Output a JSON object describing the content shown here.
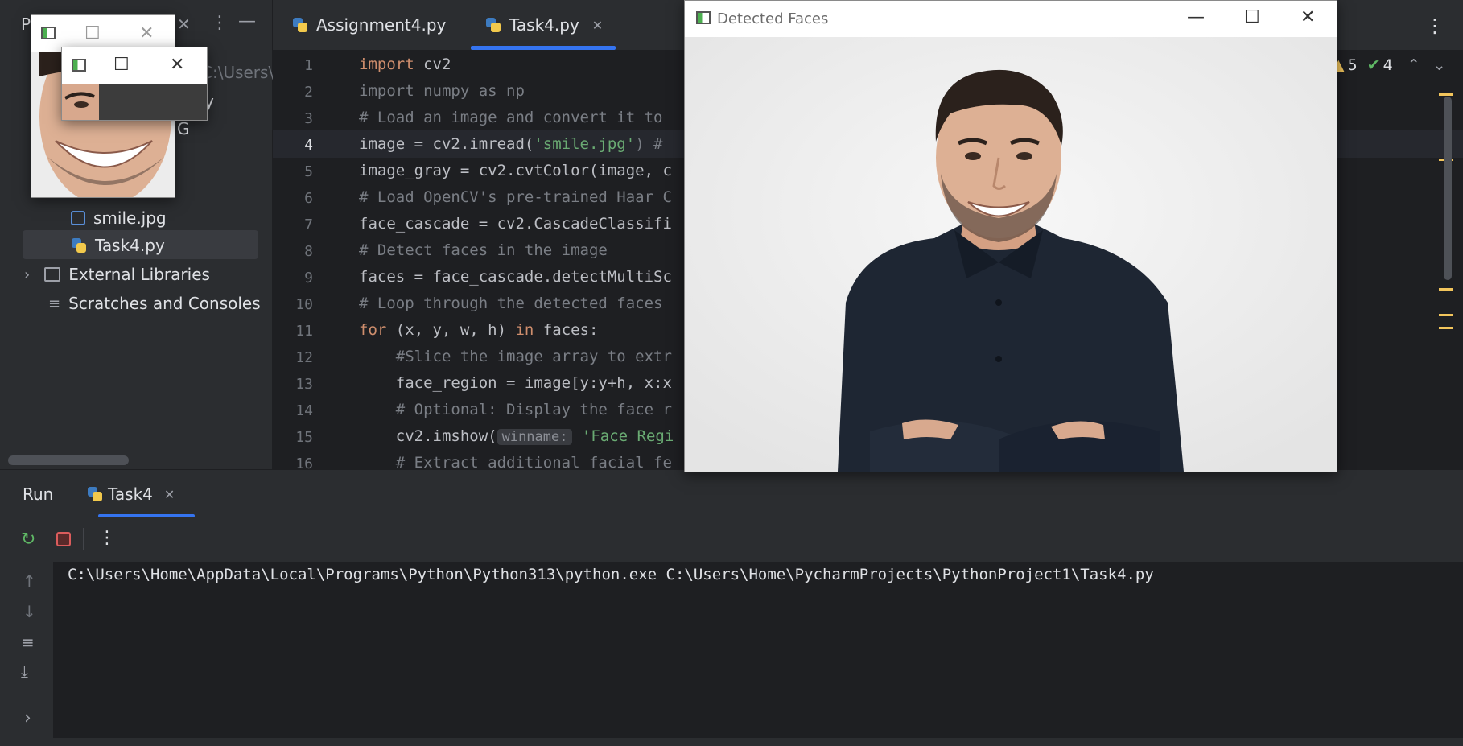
{
  "project_panel": {
    "title_fragment": "P",
    "path_fragment": "C:\\Users\\H",
    "partial_items": [
      "y",
      "G"
    ],
    "tree": [
      {
        "label": "smile.jpg",
        "icon": "image-icon"
      },
      {
        "label": "Task4.py",
        "icon": "python-file-icon",
        "selected": true
      },
      {
        "label": "External Libraries",
        "icon": "library-icon"
      },
      {
        "label": "Scratches and Consoles",
        "icon": "scratches-icon"
      }
    ]
  },
  "editor": {
    "tabs": [
      {
        "label": "Assignment4.py"
      },
      {
        "label": "Task4.py",
        "active": true
      }
    ],
    "inspections": {
      "warnings": "5",
      "ok": "4"
    },
    "line_numbers": [
      "1",
      "2",
      "3",
      "4",
      "5",
      "6",
      "7",
      "8",
      "9",
      "10",
      "11",
      "12",
      "13",
      "14",
      "15",
      "16"
    ],
    "lines": {
      "l1_kw": "import",
      "l1_rest": " cv2",
      "l2": "import numpy as np",
      "l3": "# Load an image and convert it to",
      "l4_a": "image = cv2.imread(",
      "l4_str": "'smile.jpg'",
      "l4_b": ") #",
      "l5": "image_gray = cv2.cvtColor(image, c",
      "l6": "# Load OpenCV's pre-trained Haar C",
      "l7": "face_cascade = cv2.CascadeClassifi",
      "l8": "# Detect faces in the image",
      "l9": "faces = face_cascade.detectMultiSc",
      "l10": "# Loop through the detected faces",
      "l11_kw1": "for",
      "l11_a": " (x, y, w, h) ",
      "l11_kw2": "in",
      "l11_b": " faces:",
      "l12": "    #Slice the image array to extr",
      "l13": "    face_region = image[y:y+h, x:x",
      "l14": "    # Optional: Display the face r",
      "l15_a": "    cv2.imshow(",
      "l15_hint": "winname:",
      "l15_str": " 'Face Regi",
      "l16": "    # Extract additional facial fe"
    }
  },
  "detected_faces_window": {
    "title": "Detected Faces"
  },
  "run_panel": {
    "title": "Run",
    "tab_label": "Task4",
    "console_output": "C:\\Users\\Home\\AppData\\Local\\Programs\\Python\\Python313\\python.exe C:\\Users\\Home\\PycharmProjects\\PythonProject1\\Task4.py"
  },
  "colors": {
    "background": "#1e1f22",
    "panel": "#2b2d30",
    "keyword": "#cf8e6d",
    "string": "#6aab73",
    "comment": "#7a7e85",
    "warning": "#f2c55c",
    "ok": "#5fb865",
    "stop": "#db5c5c"
  }
}
